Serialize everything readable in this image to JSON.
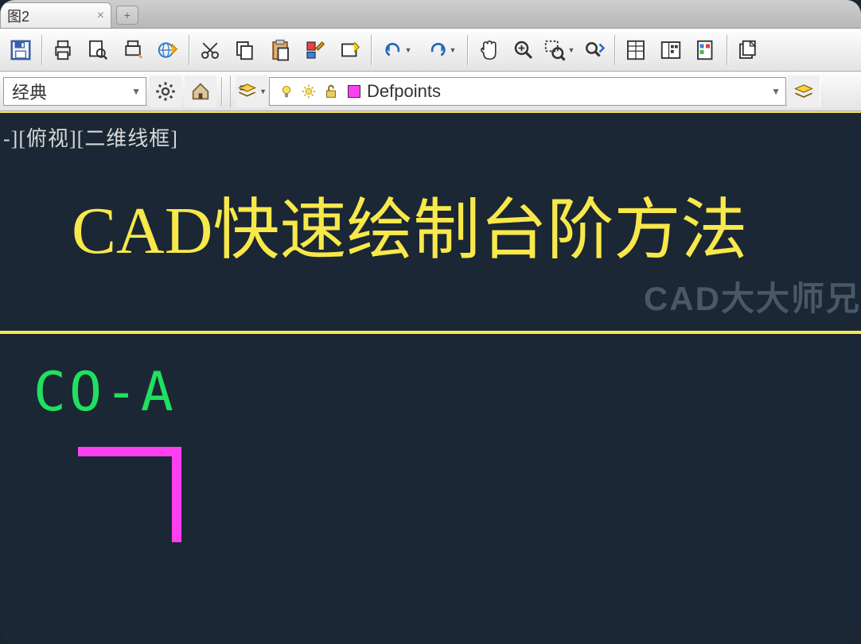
{
  "tabbar": {
    "tab_label": "图2",
    "new_tab_glyph": "+"
  },
  "workspace": {
    "selected": "经典"
  },
  "layer": {
    "selected": "Defpoints"
  },
  "canvas": {
    "viewport_label": "-][俯视][二维线框]",
    "title": "CAD快速绘制台阶方法",
    "watermark": "CAD大大师兄",
    "command": "CO-A"
  },
  "icons": {
    "close": "×",
    "dropdown": "▼"
  }
}
